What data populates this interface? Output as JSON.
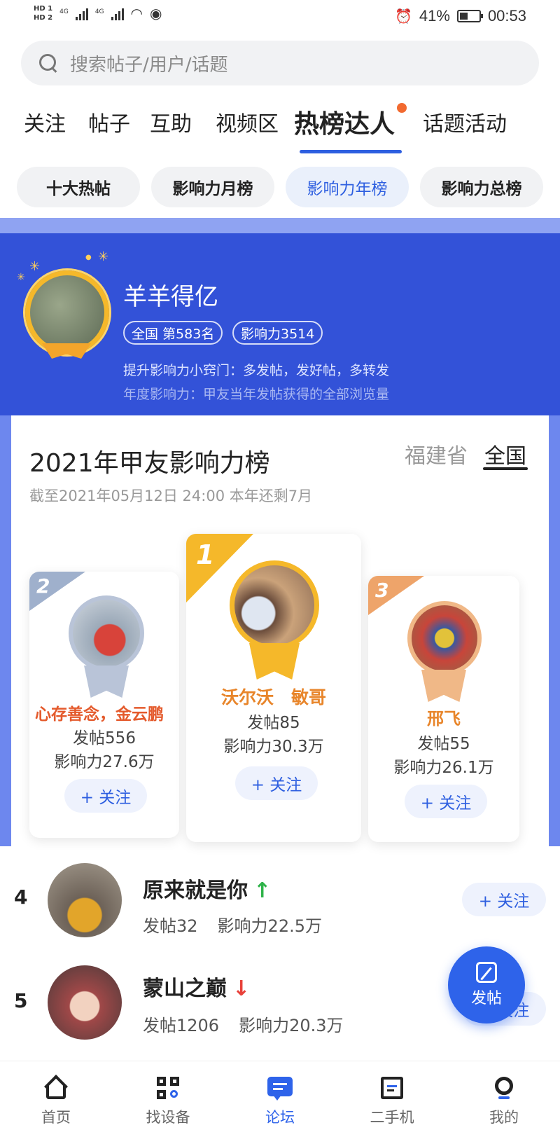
{
  "status_bar": {
    "hd1": "HD 1",
    "hd2": "HD 2",
    "net1": "4G",
    "net2": "4G",
    "battery_text": "41%",
    "battery_level": 0.41,
    "time": "00:53"
  },
  "search": {
    "placeholder": "搜索帖子/用户/话题"
  },
  "tabs": [
    {
      "label": "关注"
    },
    {
      "label": "帖子"
    },
    {
      "label": "互助"
    },
    {
      "label": "视频区"
    },
    {
      "label": "热榜达人",
      "active": true
    },
    {
      "label": "话题活动"
    }
  ],
  "subtabs": [
    {
      "label": "十大热帖"
    },
    {
      "label": "影响力月榜"
    },
    {
      "label": "影响力年榜",
      "active": true
    },
    {
      "label": "影响力总榜"
    }
  ],
  "hero": {
    "name": "羊羊得亿",
    "rank_badge": "全国  第583名",
    "influence_badge": "影响力3514",
    "tip": "提升影响力小窍门：多发帖，发好帖，多转发",
    "definition": "年度影响力：甲友当年发帖获得的全部浏览量"
  },
  "board": {
    "title": "2021年甲友影响力榜",
    "scope_options": [
      "福建省",
      "全国"
    ],
    "scope_selected": "全国",
    "subtitle": "截至2021年05月12日 24:00 本年还剩7月"
  },
  "podium": [
    {
      "rank": "2",
      "name": "心存善念，金云鹏",
      "posts": "发帖556",
      "influence": "影响力27.6万",
      "follow": "+ 关注"
    },
    {
      "rank": "1",
      "name": "沃尔沃　敏哥",
      "posts": "发帖85",
      "influence": "影响力30.3万",
      "follow": "+ 关注"
    },
    {
      "rank": "3",
      "name": "邢飞",
      "posts": "发帖55",
      "influence": "影响力26.1万",
      "follow": "+ 关注"
    }
  ],
  "list": [
    {
      "rank": "4",
      "name": "原来就是你",
      "trend": "↑",
      "posts": "发帖32",
      "influence": "影响力22.5万",
      "follow": "+ 关注"
    },
    {
      "rank": "5",
      "name": "蒙山之巅",
      "trend": "↓",
      "posts": "发帖1206",
      "influence": "影响力20.3万",
      "follow": "+ 关注"
    }
  ],
  "fab": {
    "label": "发帖"
  },
  "bottom_nav": [
    {
      "label": "首页",
      "icon": "home-icon"
    },
    {
      "label": "找设备",
      "icon": "equipment-search-icon"
    },
    {
      "label": "论坛",
      "icon": "forum-icon",
      "active": true
    },
    {
      "label": "二手机",
      "icon": "used-machine-icon"
    },
    {
      "label": "我的",
      "icon": "profile-icon"
    }
  ],
  "colors": {
    "accent": "#2e5fe0",
    "hero_bg": "#3352d8",
    "gold": "#f5b82a",
    "silver": "#a9b6cf",
    "bronze": "#eea46a",
    "up": "#2fb34a",
    "down": "#e8413a"
  }
}
